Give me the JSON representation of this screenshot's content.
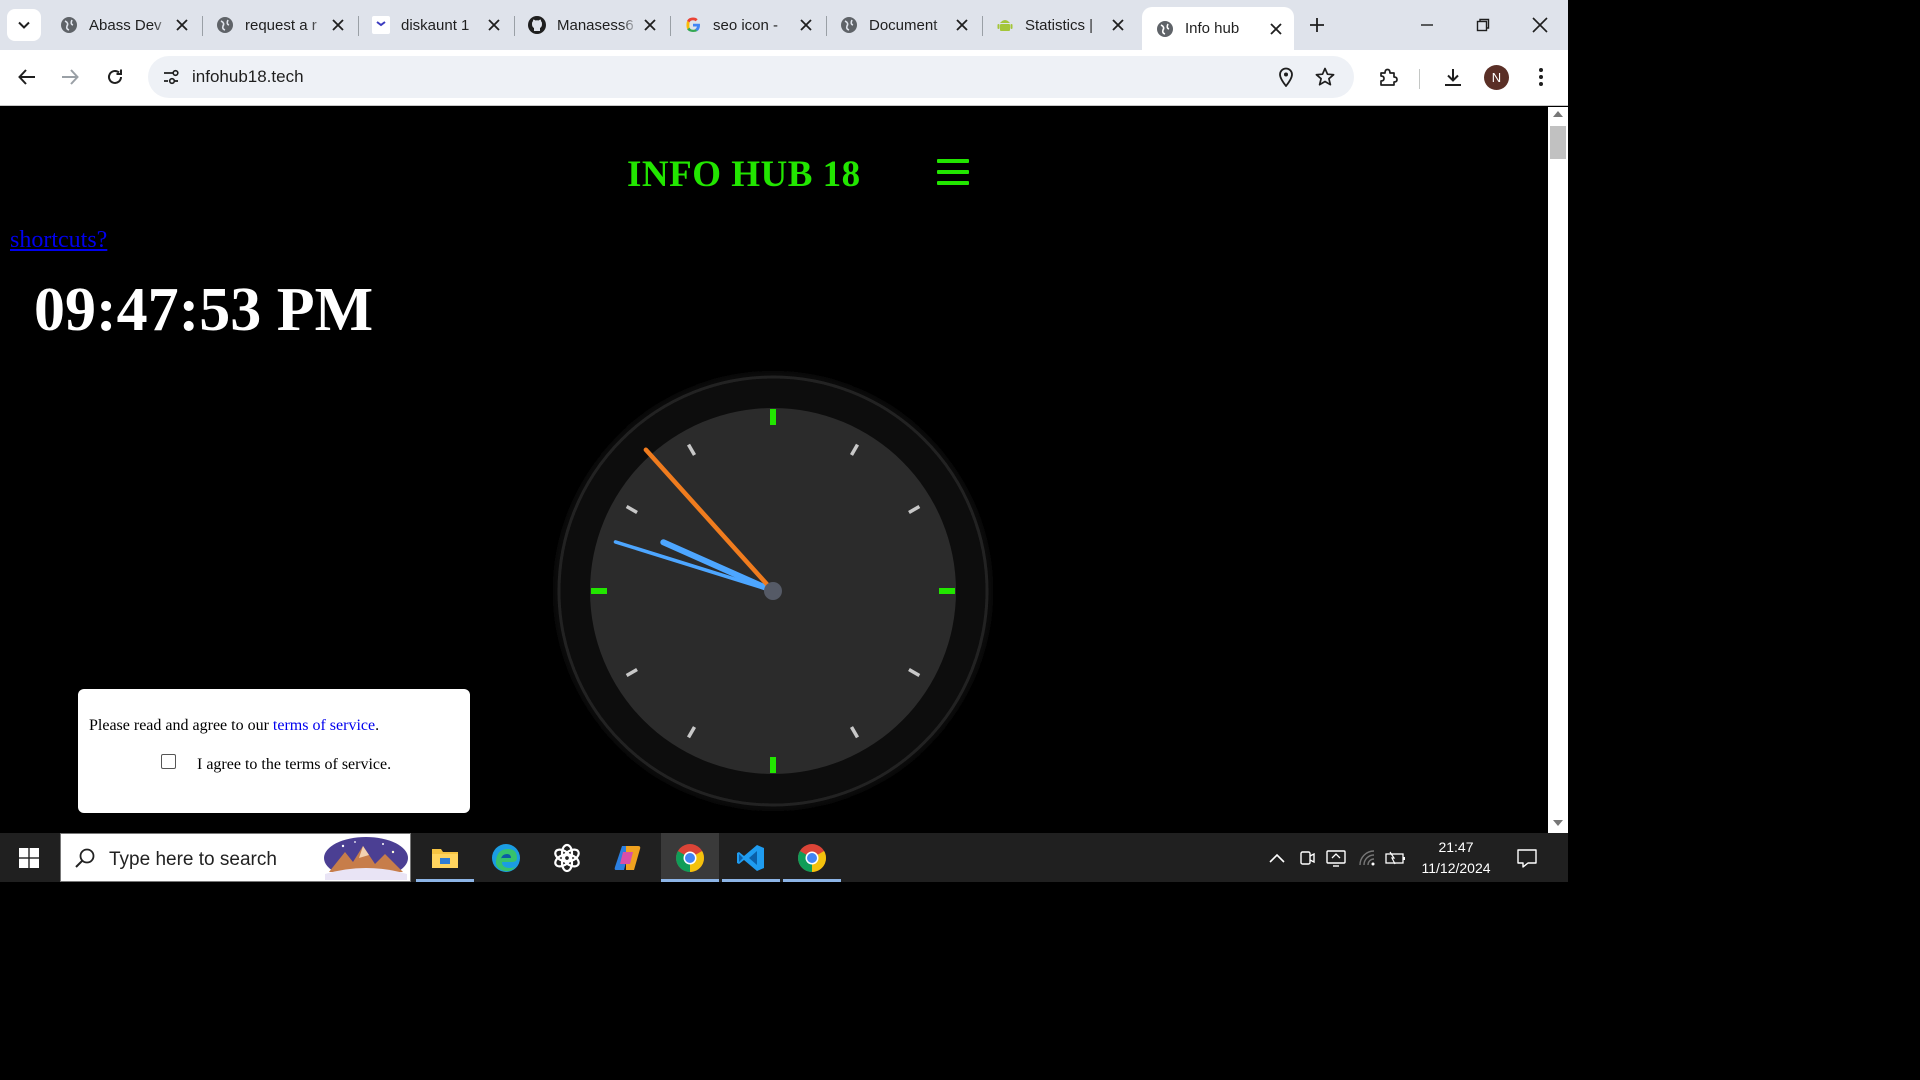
{
  "browser": {
    "tabs": [
      {
        "title": "Abass Dev",
        "icon": "globe-icon",
        "active": false
      },
      {
        "title": "request a r",
        "icon": "globe-icon",
        "active": false
      },
      {
        "title": "diskaunt 1",
        "icon": "diskaunt-favicon",
        "active": false
      },
      {
        "title": "Manasess6",
        "icon": "github-icon",
        "active": false
      },
      {
        "title": "seo icon - ",
        "icon": "google-icon",
        "active": false
      },
      {
        "title": "Document",
        "icon": "globe-icon",
        "active": false
      },
      {
        "title": "Statistics |",
        "icon": "android-icon",
        "active": false
      },
      {
        "title": "Info hub",
        "icon": "globe-icon",
        "active": true
      }
    ],
    "url": "infohub18.tech",
    "profile_initial": "N"
  },
  "page": {
    "site_title": "INFO HUB 18",
    "shortcuts_link": "shortcuts?",
    "digital_time": "09:47:53 PM",
    "clock": {
      "hours": 21,
      "minutes": 47,
      "seconds": 53,
      "accent_color": "#22e600",
      "hour_hand_color": "#4da6ff",
      "minute_hand_color": "#4da6ff",
      "second_hand_color": "#f07c1e"
    },
    "tos": {
      "prompt_before": "Please read and agree to our ",
      "link_text": "terms of service",
      "prompt_after": ".",
      "checkbox_label": "I agree to the terms of service.",
      "checked": false
    }
  },
  "taskbar": {
    "search_placeholder": "Type here to search",
    "apps": [
      "file-explorer-icon",
      "edge-icon",
      "chatgpt-icon",
      "copilot-icon",
      "chrome-icon",
      "vscode-icon",
      "chrome-icon"
    ],
    "time": "21:47",
    "date": "11/12/2024"
  }
}
